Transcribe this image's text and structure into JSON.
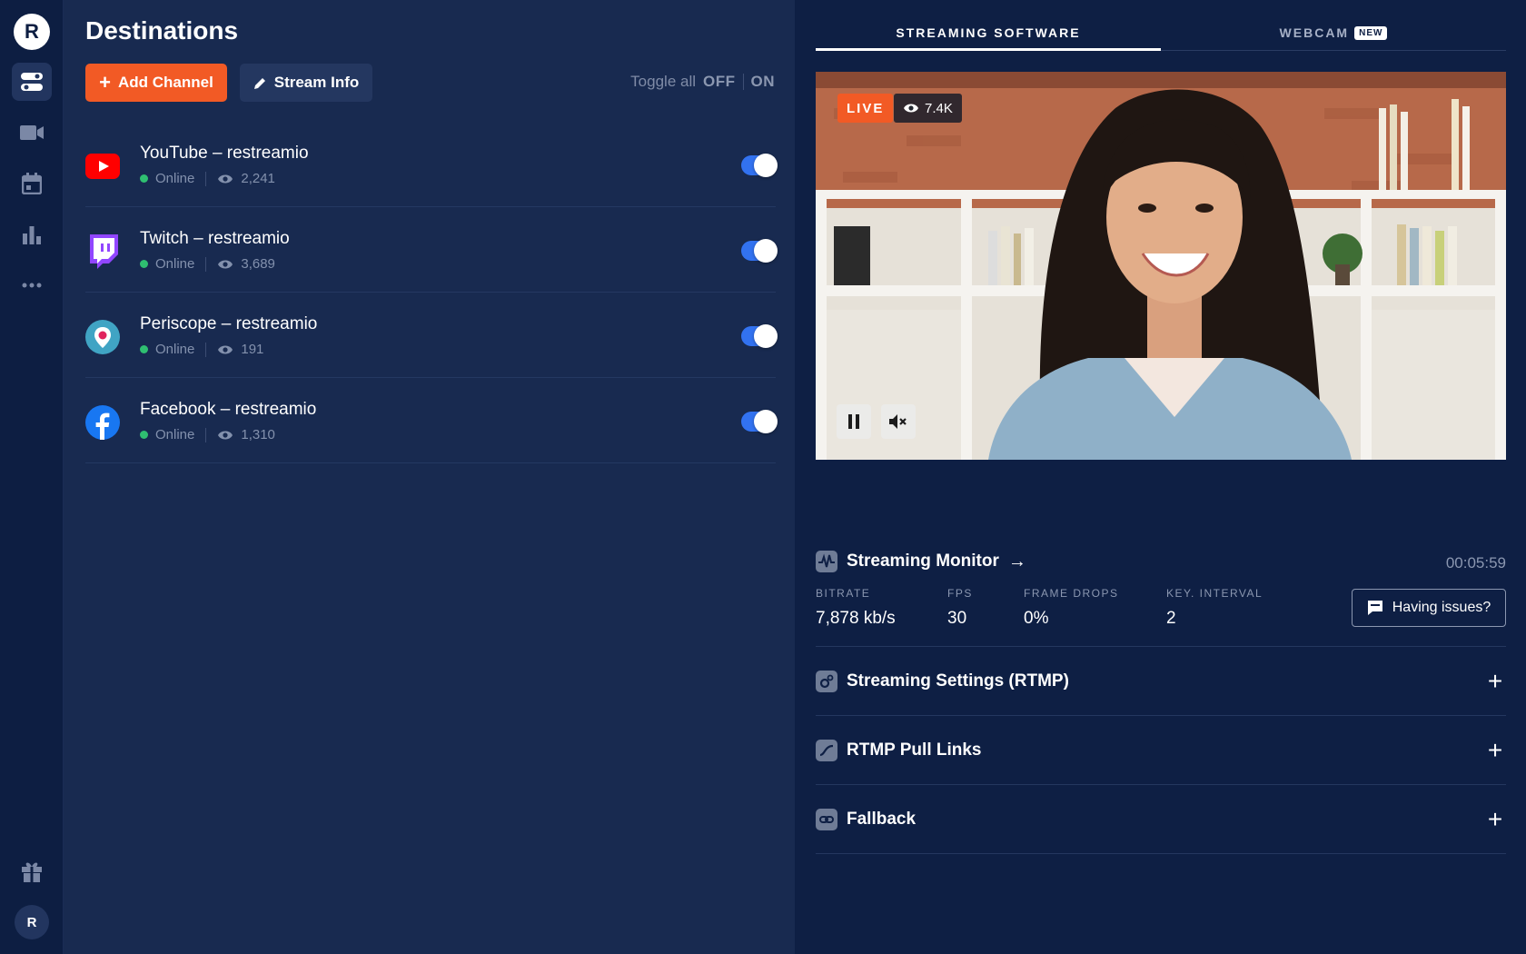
{
  "app": {
    "logo_letter": "R",
    "avatar_letter": "R"
  },
  "rail": {
    "items": [
      {
        "icon": "toggles-icon",
        "active": true
      },
      {
        "icon": "video-camera-icon",
        "active": false
      },
      {
        "icon": "calendar-icon",
        "active": false
      },
      {
        "icon": "bar-chart-icon",
        "active": false
      },
      {
        "icon": "more-dots-icon",
        "active": false
      }
    ],
    "bottom_icon": "gift-icon"
  },
  "destinations": {
    "title": "Destinations",
    "add_channel_label": "Add Channel",
    "stream_info_label": "Stream Info",
    "toggle_all_label": "Toggle all",
    "toggle_off": "OFF",
    "toggle_on": "ON",
    "channels": [
      {
        "name": "YouTube  – restreamio",
        "status": "Online",
        "viewers": "2,241",
        "icon": "youtube-icon",
        "enabled": true
      },
      {
        "name": "Twitch – restreamio",
        "status": "Online",
        "viewers": "3,689",
        "icon": "twitch-icon",
        "enabled": true
      },
      {
        "name": "Periscope – restreamio",
        "status": "Online",
        "viewers": "191",
        "icon": "periscope-icon",
        "enabled": true
      },
      {
        "name": "Facebook – restreamio",
        "status": "Online",
        "viewers": "1,310",
        "icon": "facebook-icon",
        "enabled": true
      }
    ]
  },
  "tabs": {
    "streaming_software": "STREAMING SOFTWARE",
    "webcam": "WEBCAM",
    "webcam_badge": "NEW"
  },
  "preview": {
    "live_label": "LIVE",
    "viewer_count": "7.4K"
  },
  "monitor": {
    "title": "Streaming Monitor",
    "elapsed": "00:05:59",
    "metrics": {
      "bitrate_label": "BITRATE",
      "bitrate_value": "7,878 kb/s",
      "fps_label": "FPS",
      "fps_value": "30",
      "drops_label": "FRAME DROPS",
      "drops_value": "0%",
      "key_label": "KEY. INTERVAL",
      "key_value": "2"
    },
    "issues_label": "Having issues?"
  },
  "sections": {
    "rtmp_settings": "Streaming Settings (RTMP)",
    "pull_links": "RTMP Pull Links",
    "fallback": "Fallback"
  },
  "colors": {
    "accent_orange": "#f25a25",
    "toggle_blue": "#3272f0",
    "online_green": "#2fbf71",
    "panel_bg": "#182a50",
    "app_bg": "#0e1f44"
  }
}
